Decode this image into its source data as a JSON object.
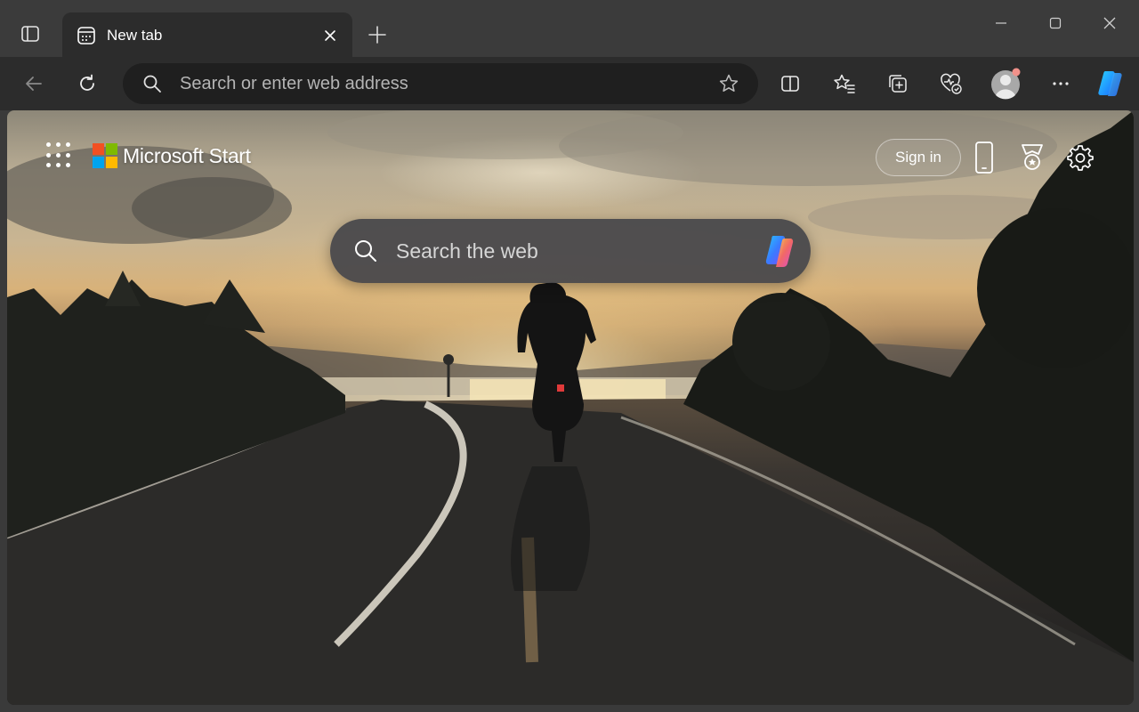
{
  "browser": {
    "tab": {
      "title": "New tab"
    },
    "address_bar": {
      "placeholder": "Search or enter web address"
    },
    "toolbar_icons": [
      "back-icon",
      "refresh-icon",
      "split-screen-icon",
      "favorites-icon",
      "collections-icon",
      "browser-essentials-icon",
      "profile-avatar",
      "more-icon",
      "copilot-icon"
    ]
  },
  "page": {
    "brand": "Microsoft Start",
    "sign_in_label": "Sign in",
    "search": {
      "placeholder": "Search the web"
    },
    "header_icons": [
      "apps-launcher-icon",
      "phone-icon",
      "rewards-icon",
      "settings-icon"
    ]
  },
  "colors": {
    "tabstrip": "#3b3b3b",
    "toolbar": "#2c2c2c",
    "addressbar": "#1f1f1f",
    "ms_red": "#f25022",
    "ms_green": "#7fba00",
    "ms_blue": "#00a4ef",
    "ms_yellow": "#ffb900"
  }
}
